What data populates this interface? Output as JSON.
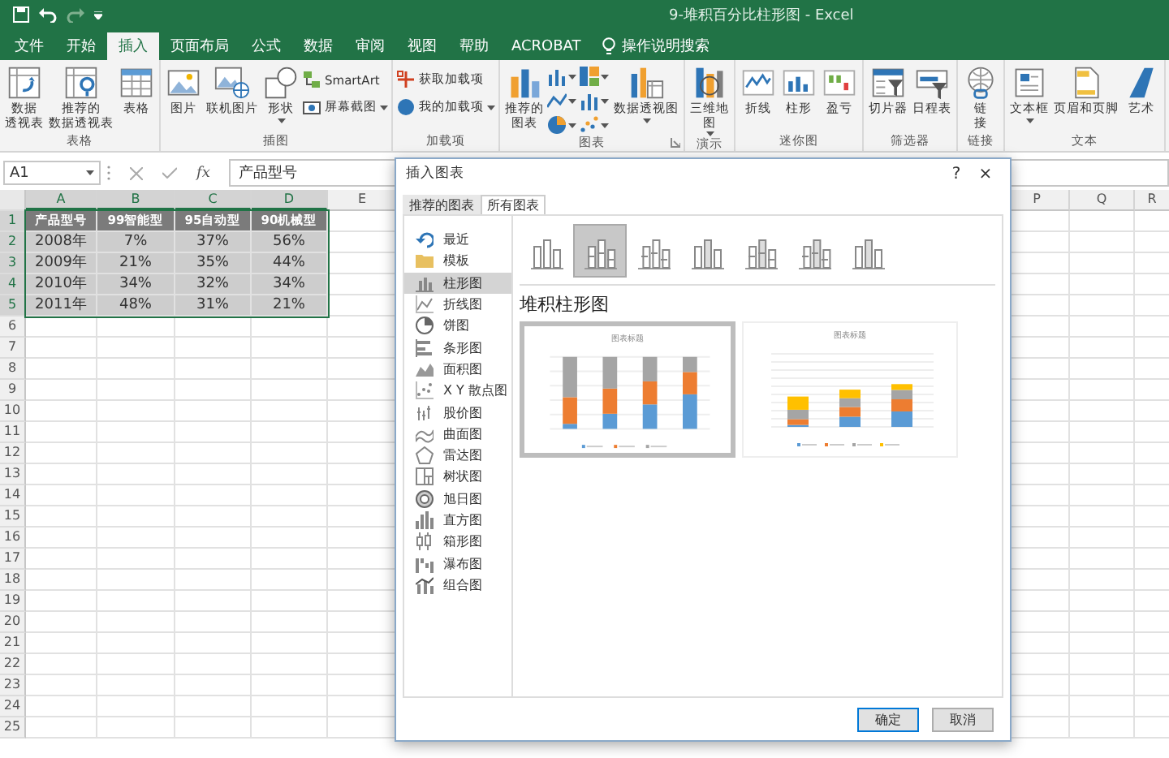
{
  "window": {
    "title": "9-堆积百分比柱形图  -  Excel"
  },
  "ribbon_tabs": [
    {
      "label": "文件",
      "selected": false
    },
    {
      "label": "开始",
      "selected": false
    },
    {
      "label": "插入",
      "selected": true
    },
    {
      "label": "页面布局",
      "selected": false
    },
    {
      "label": "公式",
      "selected": false
    },
    {
      "label": "数据",
      "selected": false
    },
    {
      "label": "审阅",
      "selected": false
    },
    {
      "label": "视图",
      "selected": false
    },
    {
      "label": "帮助",
      "selected": false
    },
    {
      "label": "ACROBAT",
      "selected": false
    }
  ],
  "tell_me": {
    "label": "操作说明搜索"
  },
  "ribbon_groups": [
    {
      "label": "表格",
      "items": [
        {
          "kind": "large",
          "lines": [
            "数据",
            "透视表"
          ]
        },
        {
          "kind": "large",
          "lines": [
            "推荐的",
            "数据透视表"
          ]
        },
        {
          "kind": "large",
          "lines": [
            "表格"
          ]
        }
      ]
    },
    {
      "label": "插图",
      "items": [
        {
          "kind": "large",
          "lines": [
            "图片"
          ]
        },
        {
          "kind": "large",
          "lines": [
            "联机图片"
          ]
        },
        {
          "kind": "large",
          "lines": [
            "形状"
          ],
          "dropdown": true
        },
        {
          "kind": "small",
          "label": "SmartArt"
        },
        {
          "kind": "small",
          "label": "屏幕截图",
          "dropdown": true
        }
      ]
    },
    {
      "label": "加载项",
      "items": [
        {
          "kind": "small",
          "label": "获取加载项"
        },
        {
          "kind": "small",
          "label": "我的加载项",
          "dropdown": true
        }
      ]
    },
    {
      "label": "图表",
      "launcher": true,
      "items": [
        {
          "kind": "large",
          "lines": [
            "推荐的",
            "图表"
          ]
        },
        {
          "kind": "icons"
        },
        {
          "kind": "large",
          "lines": [
            "数据透视图"
          ],
          "dropdown": true
        }
      ]
    },
    {
      "label": "演示",
      "items": [
        {
          "kind": "large",
          "lines": [
            "三维地",
            "图"
          ],
          "dropdown": true
        }
      ]
    },
    {
      "label": "迷你图",
      "items": [
        {
          "kind": "large",
          "lines": [
            "折线"
          ]
        },
        {
          "kind": "large",
          "lines": [
            "柱形"
          ]
        },
        {
          "kind": "large",
          "lines": [
            "盈亏"
          ]
        }
      ]
    },
    {
      "label": "筛选器",
      "items": [
        {
          "kind": "large",
          "lines": [
            "切片器"
          ]
        },
        {
          "kind": "large",
          "lines": [
            "日程表"
          ]
        }
      ]
    },
    {
      "label": "链接",
      "items": [
        {
          "kind": "large",
          "lines": [
            "链",
            "接"
          ]
        }
      ]
    },
    {
      "label": "文本",
      "items": [
        {
          "kind": "large",
          "lines": [
            "文本框"
          ],
          "dropdown": true
        },
        {
          "kind": "large",
          "lines": [
            "页眉和页脚"
          ]
        },
        {
          "kind": "large",
          "lines": [
            "艺术"
          ]
        }
      ]
    }
  ],
  "formula_bar": {
    "name_box": "A1",
    "function_label": "fx",
    "content": "产品型号"
  },
  "sheet": {
    "columns": [
      {
        "label": "A",
        "selected": true
      },
      {
        "label": "B",
        "selected": true
      },
      {
        "label": "C",
        "selected": true
      },
      {
        "label": "D",
        "selected": true
      },
      {
        "label": "E",
        "selected": false
      }
    ],
    "right_columns": [
      {
        "label": "P",
        "selected": false
      },
      {
        "label": "Q",
        "selected": false
      },
      {
        "label": "R",
        "selected": false
      }
    ],
    "rows": [
      {
        "number": "1",
        "selected": true,
        "kind": "header",
        "cells": [
          "产品型号",
          "99智能型",
          "95自动型",
          "90机械型"
        ]
      },
      {
        "number": "2",
        "selected": true,
        "kind": "data",
        "cells": [
          "2008年",
          "7%",
          "37%",
          "56%"
        ]
      },
      {
        "number": "3",
        "selected": true,
        "kind": "data",
        "cells": [
          "2009年",
          "21%",
          "35%",
          "44%"
        ]
      },
      {
        "number": "4",
        "selected": true,
        "kind": "data",
        "cells": [
          "2010年",
          "34%",
          "32%",
          "34%"
        ]
      },
      {
        "number": "5",
        "selected": true,
        "kind": "data",
        "cells": [
          "2011年",
          "48%",
          "31%",
          "21%"
        ]
      },
      {
        "number": "6",
        "selected": false
      },
      {
        "number": "7",
        "selected": false
      },
      {
        "number": "8",
        "selected": false
      },
      {
        "number": "9",
        "selected": false
      },
      {
        "number": "10",
        "selected": false
      },
      {
        "number": "11",
        "selected": false
      },
      {
        "number": "12",
        "selected": false
      },
      {
        "number": "13",
        "selected": false
      },
      {
        "number": "14",
        "selected": false
      },
      {
        "number": "15",
        "selected": false
      },
      {
        "number": "16",
        "selected": false
      },
      {
        "number": "17",
        "selected": false
      },
      {
        "number": "18",
        "selected": false
      },
      {
        "number": "19",
        "selected": false
      },
      {
        "number": "20",
        "selected": false
      },
      {
        "number": "21",
        "selected": false
      },
      {
        "number": "22",
        "selected": false
      },
      {
        "number": "23",
        "selected": false
      },
      {
        "number": "24",
        "selected": false
      },
      {
        "number": "25",
        "selected": false
      }
    ]
  },
  "dialog": {
    "title": "插入图表",
    "help": "?",
    "close": "×",
    "tabs": [
      {
        "label": "推荐的图表",
        "selected": false
      },
      {
        "label": "所有图表",
        "selected": true
      }
    ],
    "chart_types": [
      {
        "label": "最近",
        "selected": false
      },
      {
        "label": "模板",
        "selected": false
      },
      {
        "label": "柱形图",
        "selected": true
      },
      {
        "label": "折线图",
        "selected": false
      },
      {
        "label": "饼图",
        "selected": false
      },
      {
        "label": "条形图",
        "selected": false
      },
      {
        "label": "面积图",
        "selected": false
      },
      {
        "label": "X Y 散点图",
        "selected": false
      },
      {
        "label": "股价图",
        "selected": false
      },
      {
        "label": "曲面图",
        "selected": false
      },
      {
        "label": "雷达图",
        "selected": false
      },
      {
        "label": "树状图",
        "selected": false
      },
      {
        "label": "旭日图",
        "selected": false
      },
      {
        "label": "直方图",
        "selected": false
      },
      {
        "label": "箱形图",
        "selected": false
      },
      {
        "label": "瀑布图",
        "selected": false
      },
      {
        "label": "组合图",
        "selected": false
      }
    ],
    "subtypes": [
      {
        "selected": false
      },
      {
        "selected": true
      },
      {
        "selected": false
      },
      {
        "selected": false
      },
      {
        "selected": false
      },
      {
        "selected": false
      },
      {
        "selected": false
      }
    ],
    "heading": "堆积柱形图",
    "previews": [
      {
        "title": "图表标题",
        "selected": true
      },
      {
        "title": "图表标题",
        "selected": false
      }
    ],
    "buttons": [
      {
        "label": "确定",
        "kind": "primary"
      },
      {
        "label": "取消",
        "kind": "normal"
      }
    ]
  }
}
